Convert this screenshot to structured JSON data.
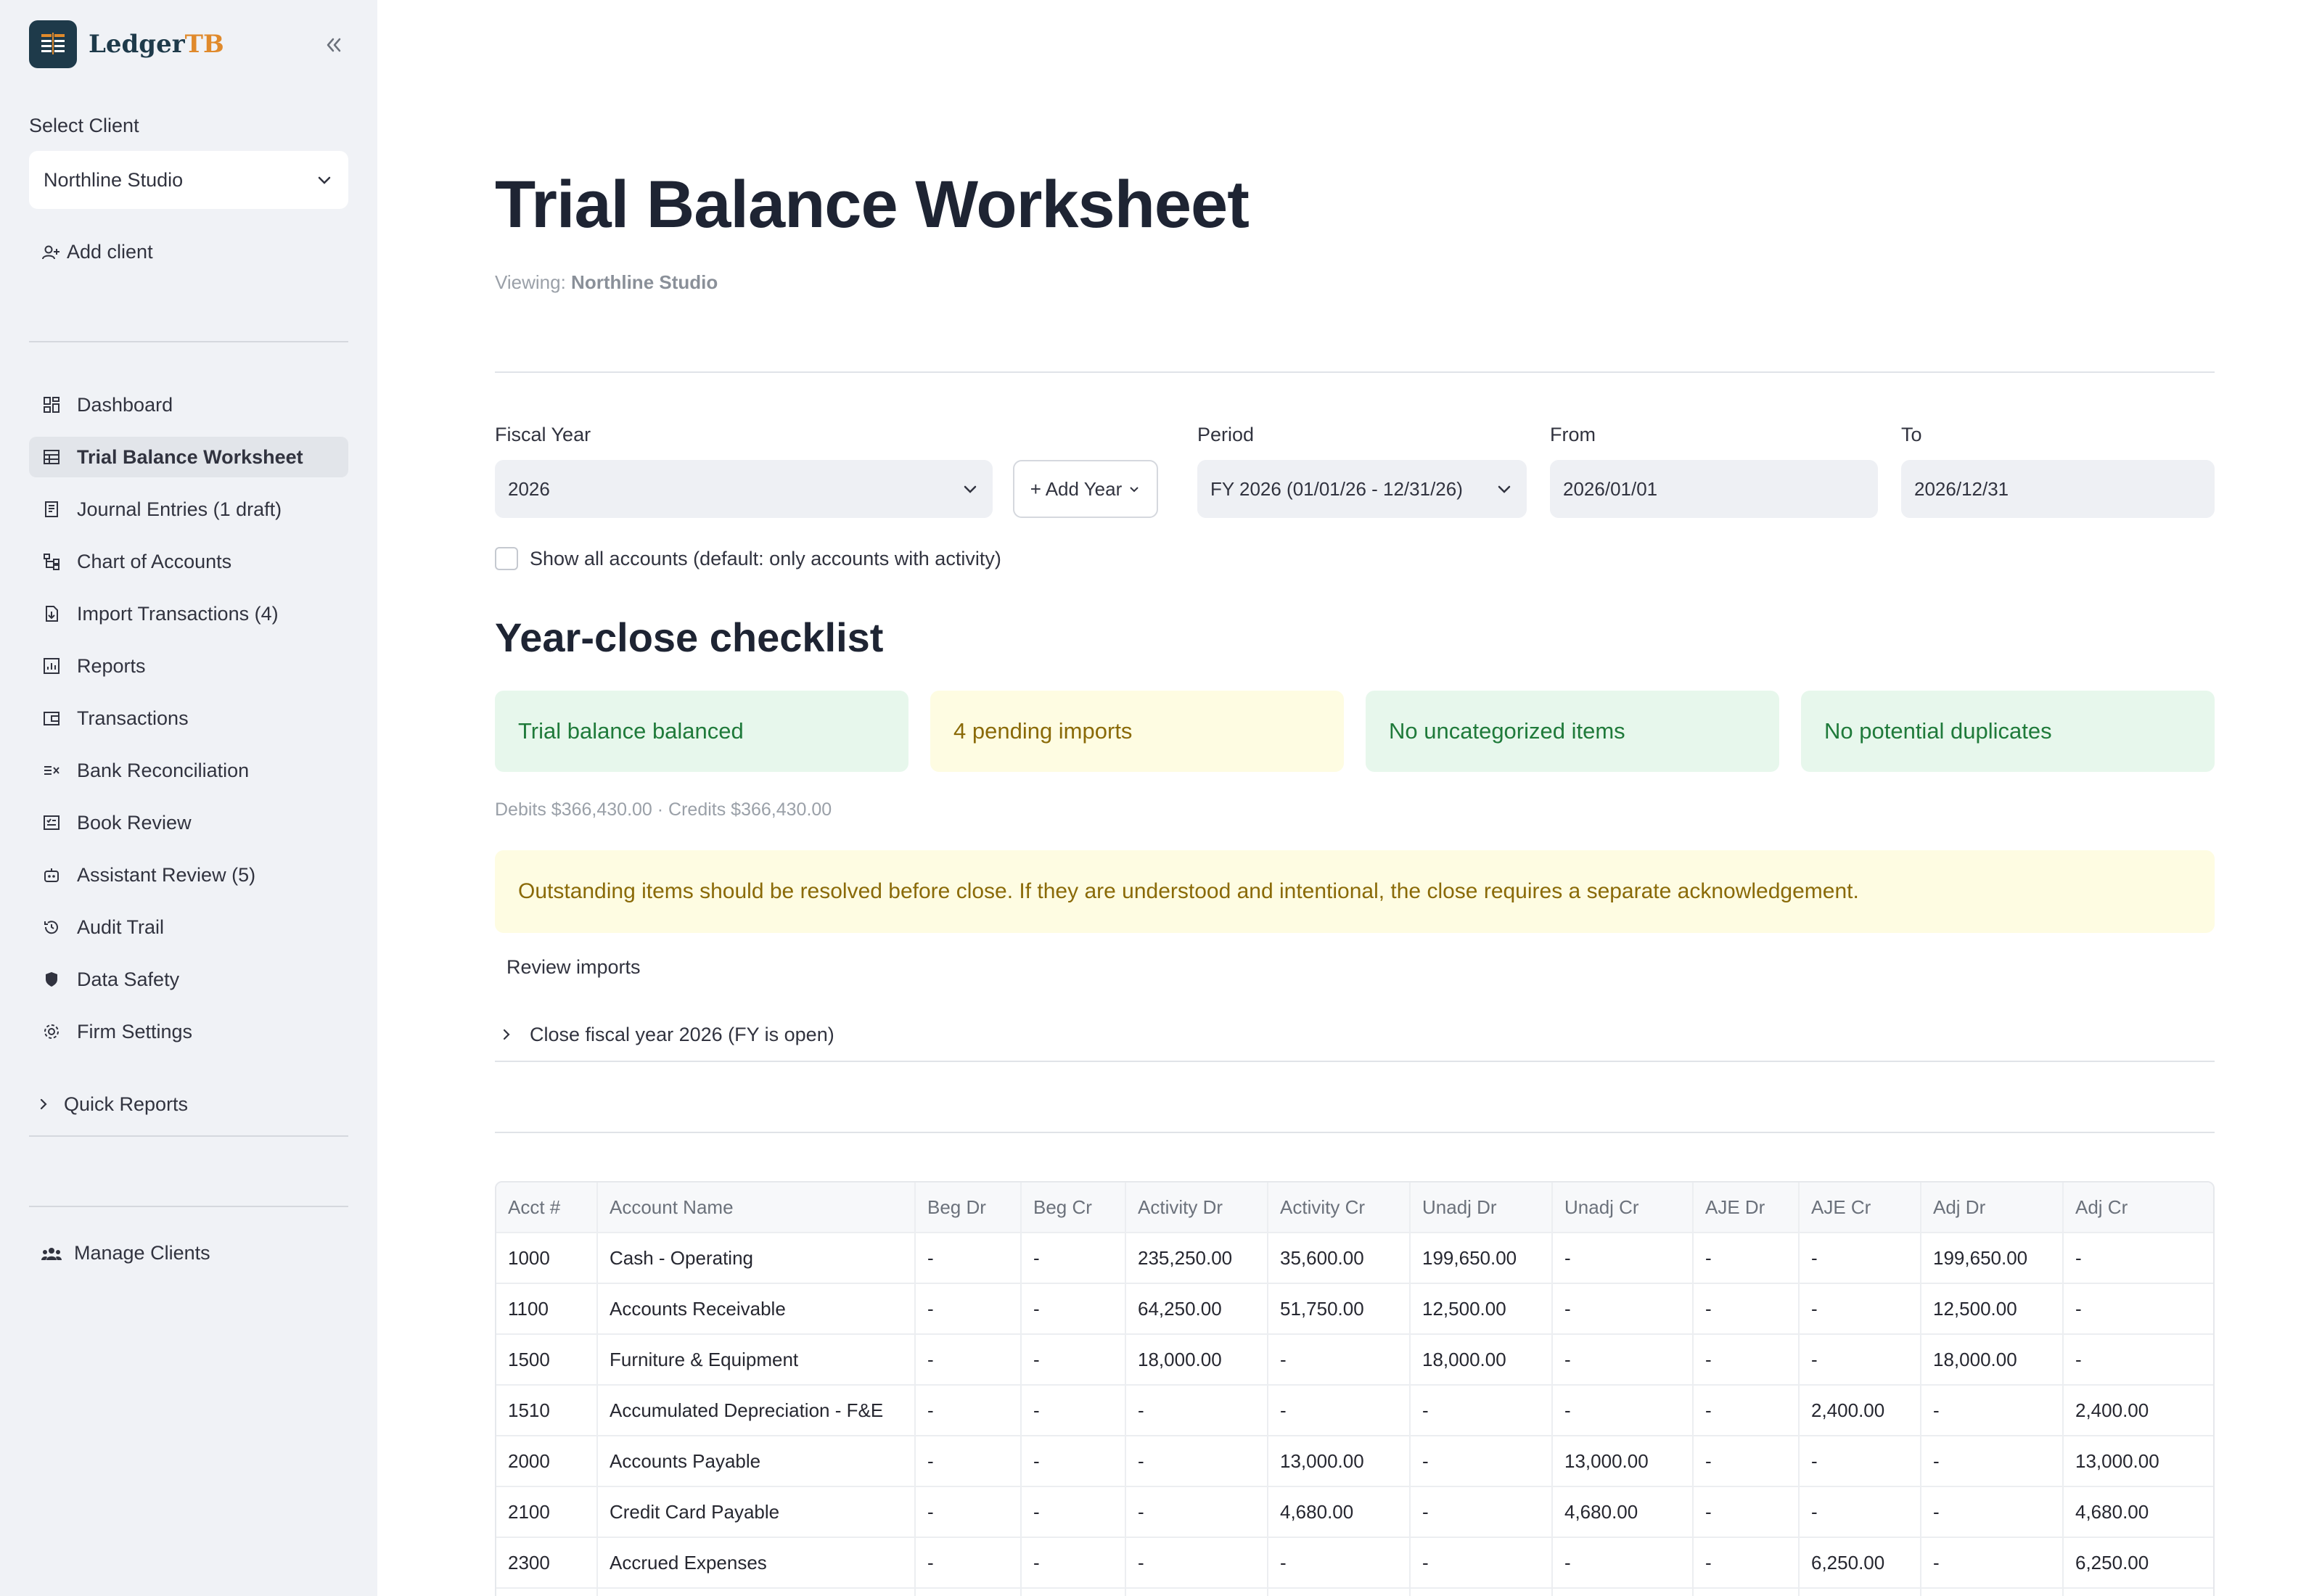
{
  "app": {
    "name_main": "Ledger",
    "name_accent": "TB",
    "brand_color": "#1e3a4a",
    "accent_color": "#e08a2c"
  },
  "sidebar": {
    "select_client_label": "Select Client",
    "selected_client": "Northline Studio",
    "add_client": "Add client",
    "items": [
      {
        "label": "Dashboard",
        "icon": "dashboard-icon"
      },
      {
        "label": "Trial Balance Worksheet",
        "icon": "table-icon",
        "active": true
      },
      {
        "label": "Journal Entries (1 draft)",
        "icon": "journal-icon"
      },
      {
        "label": "Chart of Accounts",
        "icon": "tree-icon"
      },
      {
        "label": "Import Transactions (4)",
        "icon": "import-icon"
      },
      {
        "label": "Reports",
        "icon": "report-icon"
      },
      {
        "label": "Transactions",
        "icon": "wallet-icon"
      },
      {
        "label": "Bank Reconciliation",
        "icon": "reconcile-icon"
      },
      {
        "label": "Book Review",
        "icon": "review-icon"
      },
      {
        "label": "Assistant Review (5)",
        "icon": "robot-icon"
      },
      {
        "label": "Audit Trail",
        "icon": "history-icon"
      },
      {
        "label": "Data Safety",
        "icon": "shield-icon"
      },
      {
        "label": "Firm Settings",
        "icon": "gear-icon"
      }
    ],
    "quick_reports": "Quick Reports",
    "manage_clients": "Manage Clients"
  },
  "main": {
    "title": "Trial Balance Worksheet",
    "viewing_label": "Viewing:",
    "viewing_client": "Northline Studio",
    "fiscal_year_label": "Fiscal Year",
    "fiscal_year_value": "2026",
    "add_year": "+ Add Year",
    "period_label": "Period",
    "period_value": "FY 2026 (01/01/26 - 12/31/26)",
    "from_label": "From",
    "from_value": "2026/01/01",
    "to_label": "To",
    "to_value": "2026/12/31",
    "show_all_label": "Show all accounts (default: only accounts with activity)",
    "checklist_title": "Year-close checklist",
    "checklist": [
      {
        "text": "Trial balance balanced",
        "status": "ok"
      },
      {
        "text": "4 pending imports",
        "status": "warn"
      },
      {
        "text": "No uncategorized items",
        "status": "ok"
      },
      {
        "text": "No potential duplicates",
        "status": "ok"
      }
    ],
    "totals": "Debits $366,430.00 · Credits $366,430.00",
    "alert": "Outstanding items should be resolved before close. If they are understood and intentional, the close requires a separate acknowledgement.",
    "review_imports": "Review imports",
    "close_fy": "Close fiscal year 2026 (FY is open)"
  },
  "table": {
    "columns": [
      "Acct #",
      "Account Name",
      "Beg Dr",
      "Beg Cr",
      "Activity Dr",
      "Activity Cr",
      "Unadj Dr",
      "Unadj Cr",
      "AJE Dr",
      "AJE Cr",
      "Adj Dr",
      "Adj Cr"
    ],
    "rows": [
      [
        "1000",
        "Cash - Operating",
        "-",
        "-",
        "235,250.00",
        "35,600.00",
        "199,650.00",
        "-",
        "-",
        "-",
        "199,650.00",
        "-"
      ],
      [
        "1100",
        "Accounts Receivable",
        "-",
        "-",
        "64,250.00",
        "51,750.00",
        "12,500.00",
        "-",
        "-",
        "-",
        "12,500.00",
        "-"
      ],
      [
        "1500",
        "Furniture & Equipment",
        "-",
        "-",
        "18,000.00",
        "-",
        "18,000.00",
        "-",
        "-",
        "-",
        "18,000.00",
        "-"
      ],
      [
        "1510",
        "Accumulated Depreciation - F&E",
        "-",
        "-",
        "-",
        "-",
        "-",
        "-",
        "-",
        "2,400.00",
        "-",
        "2,400.00"
      ],
      [
        "2000",
        "Accounts Payable",
        "-",
        "-",
        "-",
        "13,000.00",
        "-",
        "13,000.00",
        "-",
        "-",
        "-",
        "13,000.00"
      ],
      [
        "2100",
        "Credit Card Payable",
        "-",
        "-",
        "-",
        "4,680.00",
        "-",
        "4,680.00",
        "-",
        "-",
        "-",
        "4,680.00"
      ],
      [
        "2300",
        "Accrued Expenses",
        "-",
        "-",
        "-",
        "-",
        "-",
        "-",
        "-",
        "6,250.00",
        "-",
        "6,250.00"
      ],
      [
        "",
        "",
        "",
        "",
        "",
        "",
        "",
        "",
        "",
        "",
        "",
        ""
      ]
    ]
  }
}
